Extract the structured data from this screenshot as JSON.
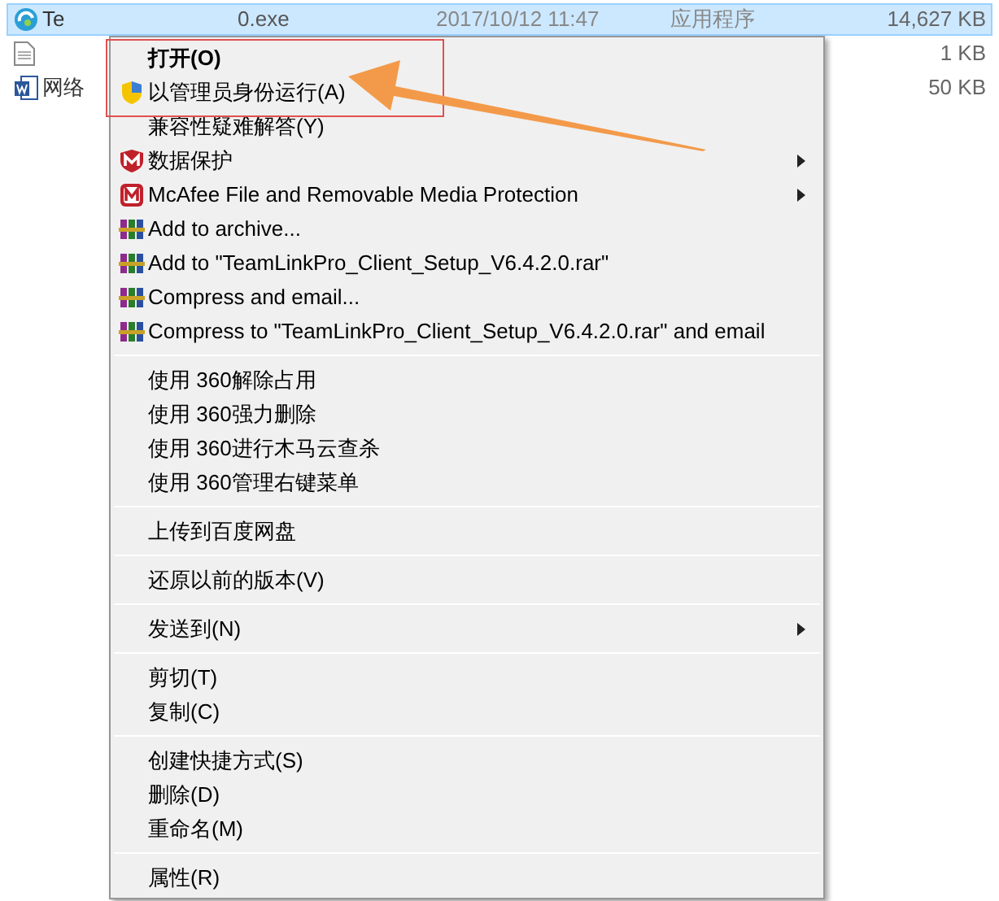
{
  "files": [
    {
      "kind": "program",
      "name": "Te",
      "name_tail": "0.exe",
      "date": "2017/10/12 11:47",
      "type": "应用程序",
      "size": "14,627 KB",
      "selected": true
    },
    {
      "kind": "text",
      "size": "1 KB",
      "selected": false
    },
    {
      "kind": "document",
      "name": "网络",
      "size": "50 KB",
      "selected": false
    }
  ],
  "context_menu": {
    "items": [
      {
        "kind": "plain",
        "label": "打开(O)",
        "bold": true
      },
      {
        "kind": "admin",
        "label": "以管理员身份运行(A)"
      },
      {
        "kind": "plain",
        "label": "兼容性疑难解答(Y)"
      },
      {
        "kind": "data-protection",
        "label": "数据保护",
        "submenu": true
      },
      {
        "kind": "mcafee",
        "label": "McAfee File and Removable Media Protection",
        "submenu": true
      },
      {
        "kind": "archive",
        "label": "Add to archive..."
      },
      {
        "kind": "archive",
        "label": "Add to \"TeamLinkPro_Client_Setup_V6.4.2.0.rar\""
      },
      {
        "kind": "archive",
        "label": "Compress and email..."
      },
      {
        "kind": "archive",
        "label": "Compress to \"TeamLinkPro_Client_Setup_V6.4.2.0.rar\" and email"
      },
      {
        "kind": "separator"
      },
      {
        "kind": "plain",
        "label": "使用 360解除占用"
      },
      {
        "kind": "plain",
        "label": "使用 360强力删除"
      },
      {
        "kind": "plain",
        "label": "使用 360进行木马云查杀"
      },
      {
        "kind": "plain",
        "label": "使用 360管理右键菜单"
      },
      {
        "kind": "separator"
      },
      {
        "kind": "plain",
        "label": "上传到百度网盘"
      },
      {
        "kind": "separator"
      },
      {
        "kind": "plain",
        "label": "还原以前的版本(V)"
      },
      {
        "kind": "separator"
      },
      {
        "kind": "plain",
        "label": "发送到(N)",
        "submenu": true
      },
      {
        "kind": "separator"
      },
      {
        "kind": "plain",
        "label": "剪切(T)"
      },
      {
        "kind": "plain",
        "label": "复制(C)"
      },
      {
        "kind": "separator"
      },
      {
        "kind": "plain",
        "label": "创建快捷方式(S)"
      },
      {
        "kind": "plain",
        "label": "删除(D)"
      },
      {
        "kind": "plain",
        "label": "重命名(M)"
      },
      {
        "kind": "separator"
      },
      {
        "kind": "plain",
        "label": "属性(R)"
      }
    ]
  }
}
